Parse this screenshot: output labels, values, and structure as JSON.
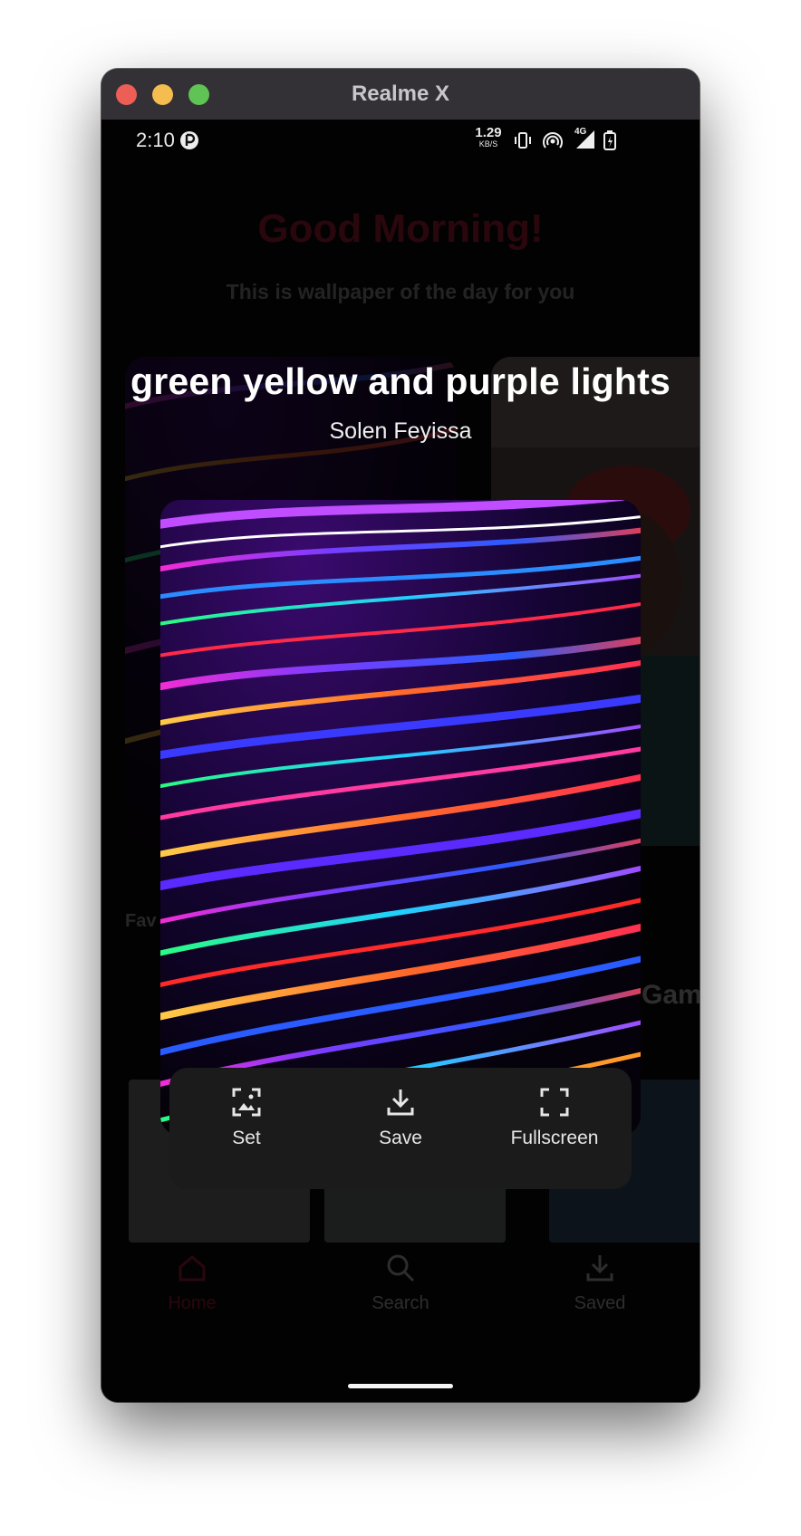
{
  "window": {
    "title": "Realme X"
  },
  "status_bar": {
    "time": "2:10",
    "net_speed": "1.29",
    "net_unit": "KB/S",
    "network_type": "4G"
  },
  "home": {
    "greeting": "Good Morning!",
    "subtitle": "This is wallpaper of the day for you",
    "favourites_label": "Fav",
    "category_label": "Gamin"
  },
  "wallpaper": {
    "title": "green yellow and purple lights",
    "author": "Solen Feyissa"
  },
  "actions": [
    {
      "label": "Set",
      "icon": "wallpaper-set-icon"
    },
    {
      "label": "Save",
      "icon": "download-icon"
    },
    {
      "label": "Fullscreen",
      "icon": "fullscreen-icon"
    }
  ],
  "bottom_nav": [
    {
      "label": "Home",
      "icon": "home-icon",
      "active": true
    },
    {
      "label": "Search",
      "icon": "search-icon",
      "active": false
    },
    {
      "label": "Saved",
      "icon": "download-icon",
      "active": false
    }
  ],
  "colors": {
    "accent": "#c4203a",
    "background": "#030203",
    "panel": "#1b1b1c"
  }
}
